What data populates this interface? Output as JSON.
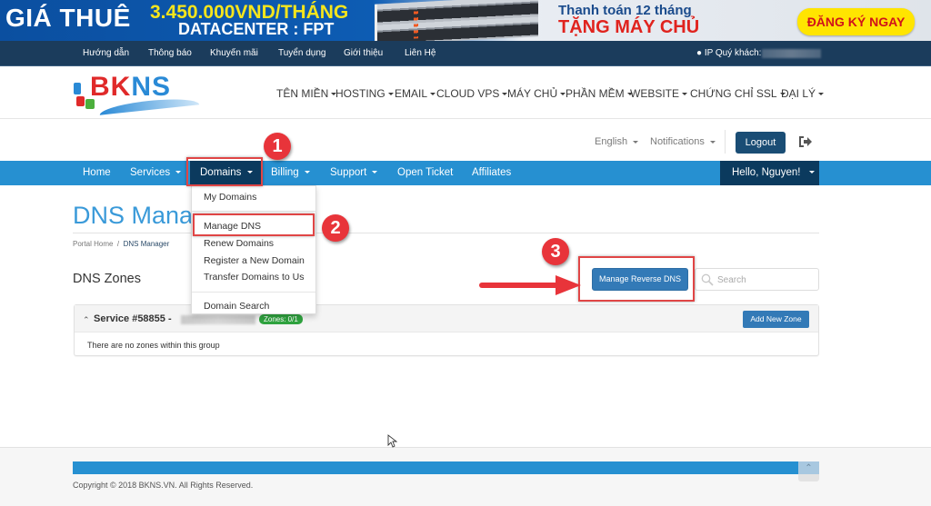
{
  "banner": {
    "headline": "GIÁ THUÊ",
    "price": "3.450.000VND/THÁNG",
    "datacenter": "DATACENTER : FPT",
    "promo_line1": "Thanh toán 12 tháng",
    "promo_line2": "TẶNG MÁY CHỦ",
    "cta_label": "ĐĂNG KÝ NGAY"
  },
  "topbar": {
    "links": [
      "Hướng dẫn",
      "Thông báo",
      "Khuyến mãi",
      "Tuyển dụng",
      "Giới thiệu",
      "Liên Hệ"
    ],
    "ip_label": "IP Quý khách:"
  },
  "logo": {
    "text_red": "BK",
    "text_blue": "NS"
  },
  "main_nav": {
    "items": [
      "TÊN MIỀN",
      "HOSTING",
      "EMAIL",
      "CLOUD VPS",
      "MÁY CHỦ",
      "PHẦN MỀM",
      "WEBSITE",
      "CHỨNG CHỈ SSL",
      "ĐẠI LÝ"
    ]
  },
  "userbar": {
    "language": "English",
    "notifications": "Notifications",
    "logout_label": "Logout"
  },
  "portal_nav": {
    "items": [
      "Home",
      "Services",
      "Domains",
      "Billing",
      "Support",
      "Open Ticket",
      "Affiliates"
    ],
    "active": "Domains",
    "greeting": "Hello, Nguyen!"
  },
  "domains_menu": {
    "items": [
      "My Domains",
      "Manage DNS",
      "Renew Domains",
      "Register a New Domain",
      "Transfer Domains to Us",
      "Domain Search"
    ]
  },
  "annotations": {
    "step1": "1",
    "step2": "2",
    "step3": "3"
  },
  "page": {
    "title": "DNS Manager",
    "breadcrumb": [
      "Portal Home",
      "DNS Manager"
    ],
    "breadcrumb_sep": "/",
    "section_title": "DNS Zones",
    "manage_reverse_dns_label": "Manage Reverse DNS",
    "search_placeholder": "Search"
  },
  "service_panel": {
    "title": "Service #58855 -",
    "zones_badge": "Zones: 0/1",
    "add_zone_label": "Add New Zone",
    "empty_message": "There are no zones within this group"
  },
  "footer": {
    "copyright": "Copyright © 2018 BKNS.VN. All Rights Reserved."
  },
  "colors": {
    "portal_nav_bg": "#2690d1",
    "portal_nav_active": "#0b3a5e",
    "primary_button": "#337ab7",
    "annotation_red": "#e8343a",
    "zones_badge": "#2fa33f",
    "topbar_bg": "#1b3c5c"
  }
}
